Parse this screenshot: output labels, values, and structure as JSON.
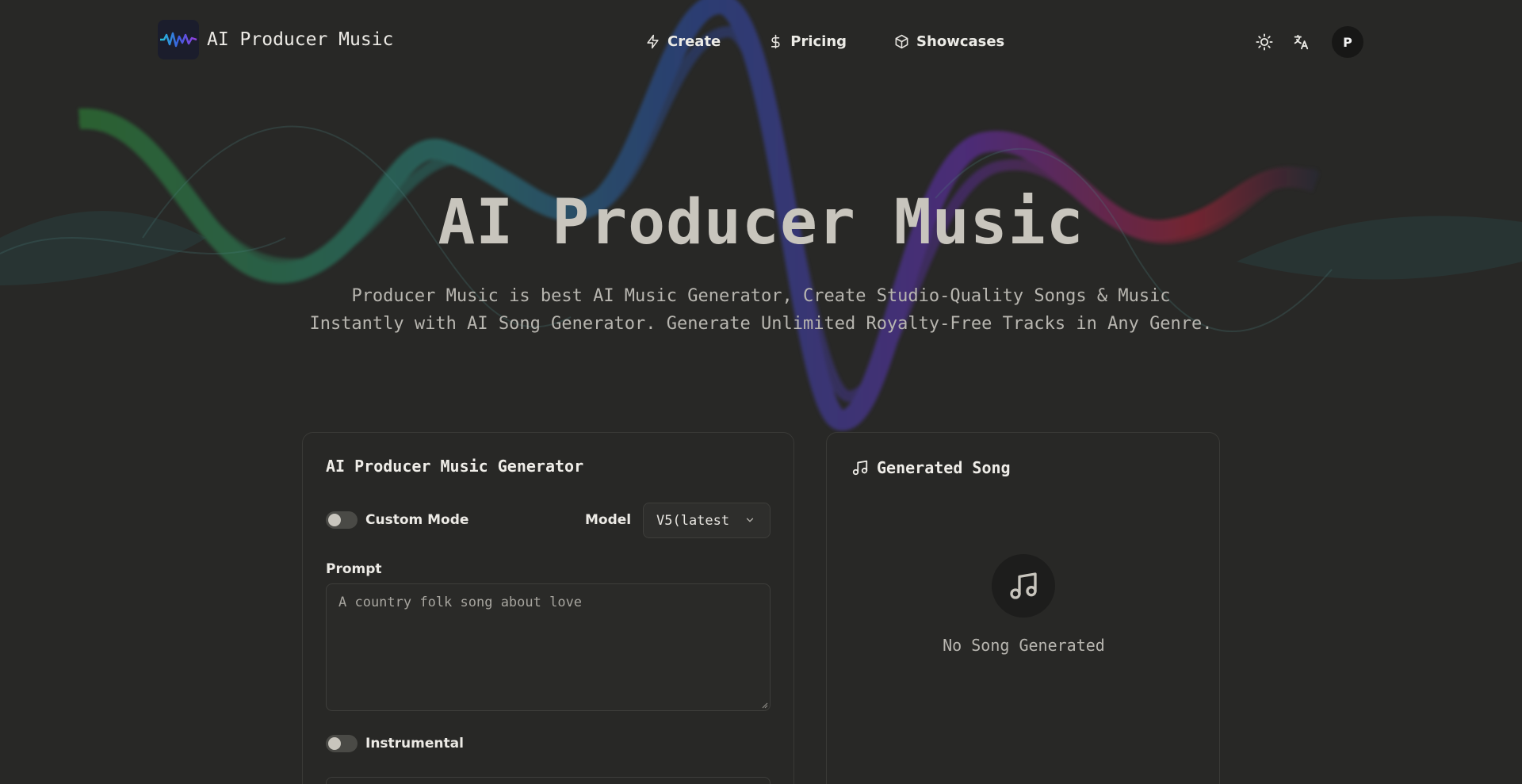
{
  "brand": {
    "name": "AI Producer Music"
  },
  "nav": {
    "items": [
      {
        "label": "Create",
        "icon": "zap-icon"
      },
      {
        "label": "Pricing",
        "icon": "dollar-icon"
      },
      {
        "label": "Showcases",
        "icon": "box-icon"
      }
    ]
  },
  "header_actions": {
    "theme_icon": "sun-icon",
    "language_icon": "translate-icon",
    "avatar_initial": "P"
  },
  "hero": {
    "title": "AI Producer Music",
    "subtitle_line1": "Producer Music is best AI Music Generator, Create Studio-Quality Songs & Music",
    "subtitle_line2": "Instantly with AI Song Generator. Generate Unlimited Royalty-Free Tracks in Any Genre."
  },
  "generator": {
    "title": "AI Producer Music Generator",
    "custom_mode_label": "Custom Mode",
    "custom_mode_on": false,
    "model_label": "Model",
    "model_value": "V5(latest",
    "prompt_label": "Prompt",
    "prompt_value": "A country folk song about love",
    "instrumental_label": "Instrumental",
    "instrumental_on": false
  },
  "song_panel": {
    "title": "Generated Song",
    "empty_text": "No Song Generated"
  },
  "colors": {
    "background": "#282826",
    "wave_green": "#2f8f3a",
    "wave_teal": "#2a8a86",
    "wave_blue": "#2d4fb0",
    "wave_purple": "#6a2fb8",
    "wave_red": "#b0243a"
  }
}
